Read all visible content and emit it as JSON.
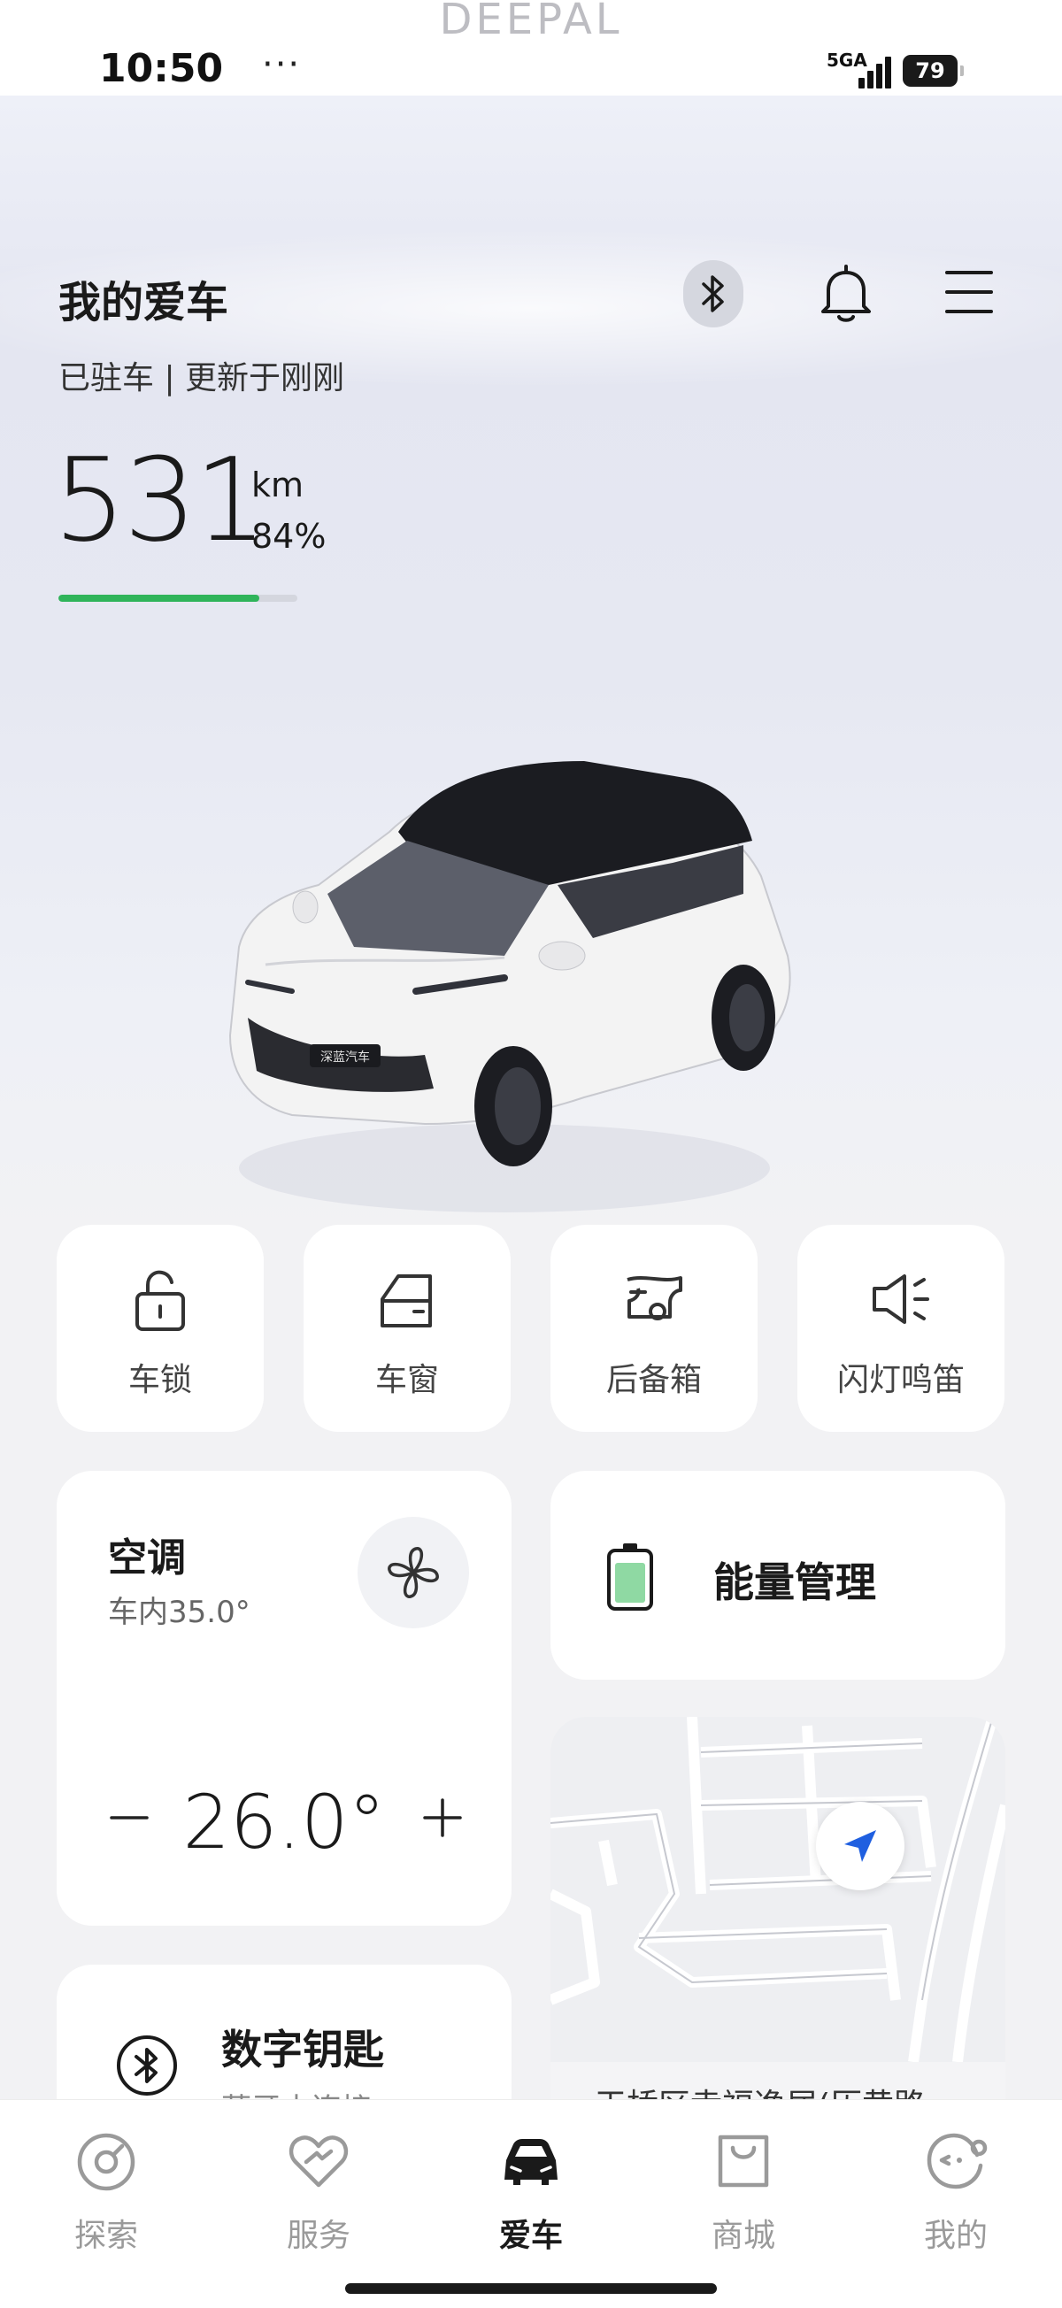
{
  "status_bar": {
    "brand": "DEEPAL",
    "time": "10:50",
    "dots": "···",
    "network": "5GA",
    "battery": "79"
  },
  "header": {
    "title": "我的爱车",
    "status": "已驻车 | 更新于刚刚",
    "icons": [
      "bluetooth-icon",
      "bell-icon",
      "menu-icon"
    ]
  },
  "range": {
    "value": "531",
    "unit": "km",
    "percent_label": "84%",
    "battery_fraction": 0.84,
    "bar_color": "#2fb45a"
  },
  "quick_controls": [
    {
      "label": "车锁",
      "icon": "lock-icon"
    },
    {
      "label": "车窗",
      "icon": "window-icon"
    },
    {
      "label": "后备箱",
      "icon": "trunk-icon"
    },
    {
      "label": "闪灯鸣笛",
      "icon": "horn-icon"
    }
  ],
  "climate": {
    "title": "空调",
    "interior": "车内35.0°",
    "minus": "−",
    "temperature": "26.0°",
    "plus": "+"
  },
  "energy": {
    "label": "能量管理"
  },
  "map": {
    "address": "天桥区幸福逸居(历黄路"
  },
  "digital_key": {
    "title": "数字钥匙",
    "subtitle": "蓝牙未连接"
  },
  "tabs": [
    {
      "label": "探索",
      "icon": "explore-icon",
      "active": false
    },
    {
      "label": "服务",
      "icon": "service-icon",
      "active": false
    },
    {
      "label": "爱车",
      "icon": "car-icon",
      "active": true
    },
    {
      "label": "商城",
      "icon": "shop-icon",
      "active": false
    },
    {
      "label": "我的",
      "icon": "profile-icon",
      "active": false
    }
  ],
  "colors": {
    "accent_green": "#2fb45a",
    "locate_blue": "#1f5fe0"
  }
}
